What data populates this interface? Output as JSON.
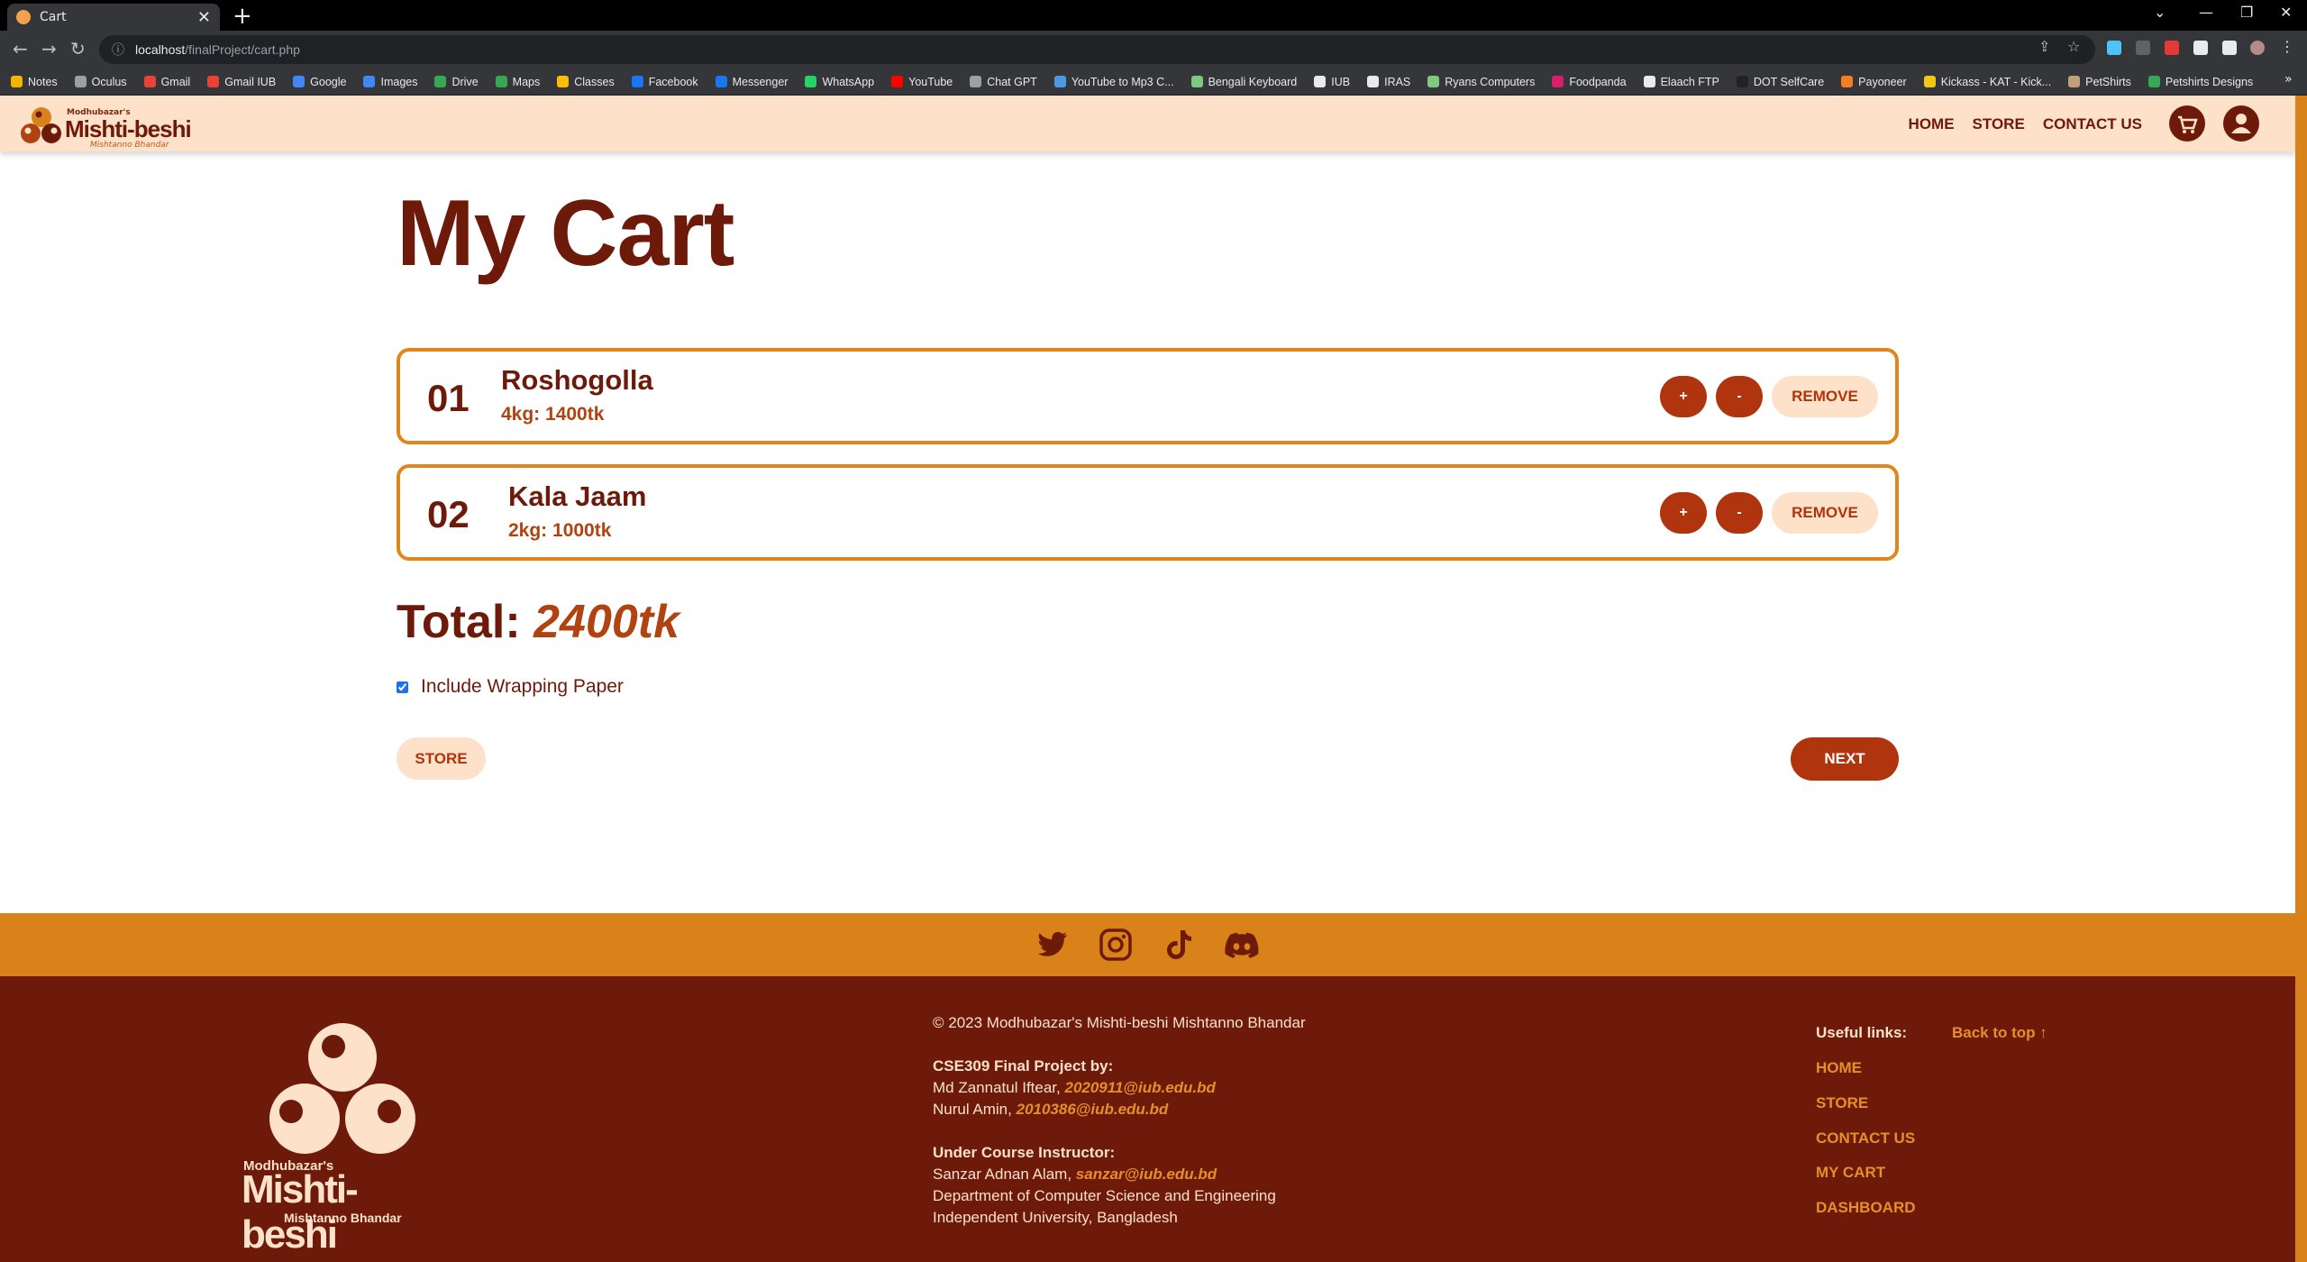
{
  "browser": {
    "tab_title": "Cart",
    "tab_close": "✕",
    "new_tab": "+",
    "url_host": "localhost",
    "url_path": "/finalProject/cart.php",
    "bookmarks": [
      "Notes",
      "Oculus",
      "Gmail",
      "Gmail IUB",
      "Google",
      "Images",
      "Drive",
      "Maps",
      "Classes",
      "Facebook",
      "Messenger",
      "WhatsApp",
      "YouTube",
      "Chat GPT",
      "YouTube to Mp3 C...",
      "Bengali Keyboard",
      "IUB",
      "IRAS",
      "Ryans Computers",
      "Foodpanda",
      "Elaach FTP",
      "DOT SelfCare",
      "Payoneer",
      "Kickass - KAT - Kick...",
      "PetShirts",
      "Petshirts Designs"
    ],
    "bookmark_colors": [
      "#f4b400",
      "#9aa0a6",
      "#ea4335",
      "#ea4335",
      "#4285f4",
      "#4285f4",
      "#34a853",
      "#34a853",
      "#fbbc04",
      "#1877f2",
      "#1877f2",
      "#25d366",
      "#ff0000",
      "#9aa0a6",
      "#4a9be0",
      "#7fc97f",
      "#e8eaed",
      "#e8eaed",
      "#7fc97f",
      "#d71f6b",
      "#e8eaed",
      "#222222",
      "#f57f20",
      "#f5c518",
      "#c0a07a",
      "#34a853"
    ]
  },
  "site": {
    "logo_small": "Modhubazar's",
    "logo_big": "Mishti-beshi",
    "logo_sub": "Mishtanno Bhandar",
    "nav": [
      "HOME",
      "STORE",
      "CONTACT US"
    ]
  },
  "cart": {
    "title": "My Cart",
    "items": [
      {
        "num": "01",
        "name": "Roshogolla",
        "detail": "4kg: 1400tk"
      },
      {
        "num": "02",
        "name": "Kala Jaam",
        "detail": "2kg: 1000tk"
      }
    ],
    "plus_label": "+",
    "minus_label": "-",
    "remove_label": "REMOVE",
    "total_label": "Total:",
    "total_value": "2400tk",
    "wrap_label": "Include Wrapping Paper",
    "wrap_checked": true,
    "store_label": "STORE",
    "next_label": "NEXT"
  },
  "footer": {
    "copyright": "© 2023 Modhubazar's Mishti-beshi Mishtanno Bhandar",
    "project_heading": "CSE309 Final Project by:",
    "authors": [
      {
        "name": "Md Zannatul Iftear,",
        "email": "2020911@iub.edu.bd"
      },
      {
        "name": "Nurul Amin,",
        "email": "2010386@iub.edu.bd"
      }
    ],
    "instructor_heading": "Under Course Instructor:",
    "instructor_name": "Sanzar Adnan Alam,",
    "instructor_email": "sanzar@iub.edu.bd",
    "dept": "Department of Computer Science and Engineering",
    "university": "Independent University, Bangladesh",
    "useful_label": "Useful links:",
    "back_to_top": "Back to top ↑",
    "links": [
      "HOME",
      "STORE",
      "CONTACT US",
      "MY CART",
      "DASHBOARD"
    ]
  },
  "colors": {
    "brand_dark": "#6d1a0b",
    "brand_orange": "#d98219",
    "brand_cream": "#fde1c8",
    "accent": "#b0340e"
  }
}
